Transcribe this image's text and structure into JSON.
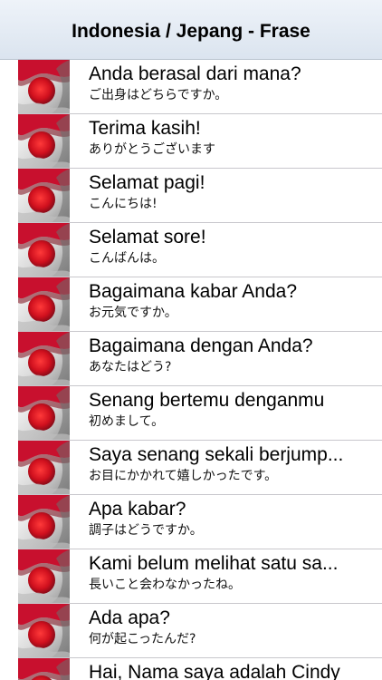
{
  "navbar": {
    "title": "Indonesia / Jepang - Frase"
  },
  "rows": [
    {
      "title": "Anda berasal dari mana?",
      "subtitle": "ご出身はどちらですか。"
    },
    {
      "title": "Terima kasih!",
      "subtitle": "ありがとうございます"
    },
    {
      "title": "Selamat pagi!",
      "subtitle": "こんにちは!"
    },
    {
      "title": "Selamat sore!",
      "subtitle": "こんばんは。"
    },
    {
      "title": "Bagaimana kabar Anda?",
      "subtitle": "お元気ですか。"
    },
    {
      "title": "Bagaimana dengan Anda?",
      "subtitle": "あなたはどう?"
    },
    {
      "title": "Senang bertemu denganmu",
      "subtitle": "初めまして。"
    },
    {
      "title": "Saya senang sekali berjump...",
      "subtitle": "お目にかかれて嬉しかったです。"
    },
    {
      "title": "Apa kabar?",
      "subtitle": "調子はどうですか。"
    },
    {
      "title": "Kami belum melihat satu sa...",
      "subtitle": "長いこと会わなかったね。"
    },
    {
      "title": "Ada apa?",
      "subtitle": "何が起こったんだ?"
    },
    {
      "title": "Hai, Nama saya adalah Cindy",
      "subtitle": ""
    }
  ],
  "icons": {
    "row_icon": "indonesia-japan-flag-icon",
    "flag_colors": {
      "red": "#c8102e",
      "dark_red": "#7a0a17",
      "white": "#f4f4f4",
      "shadow": "#9a9a9a"
    }
  }
}
